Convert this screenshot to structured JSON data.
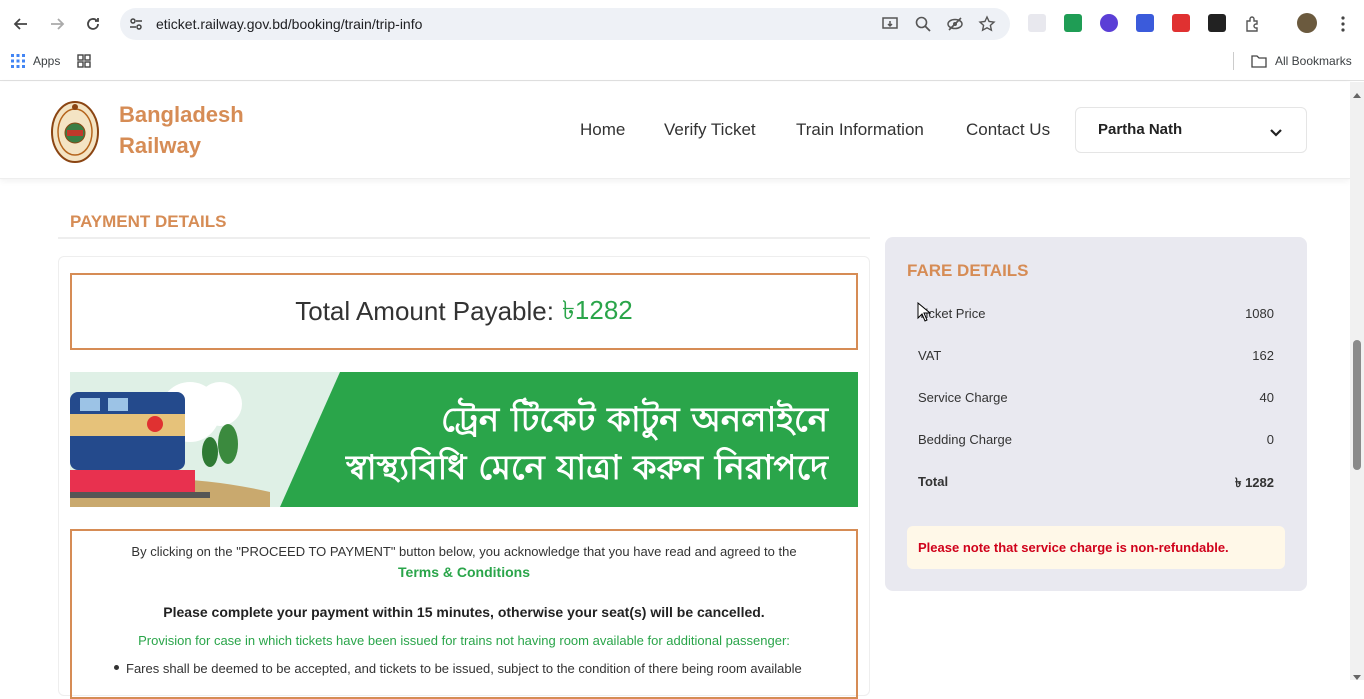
{
  "browser": {
    "url": "eticket.railway.gov.bd/booking/train/trip-info",
    "bookmarks": {
      "apps_label": "Apps",
      "all_bookmarks_label": "All Bookmarks"
    }
  },
  "site": {
    "brand_line1": "Bangladesh",
    "brand_line2": "Railway",
    "nav": [
      "Home",
      "Verify Ticket",
      "Train Information",
      "Contact Us"
    ],
    "user_name": "Partha Nath"
  },
  "payment": {
    "section_title": "PAYMENT DETAILS",
    "total_label": "Total Amount Payable:",
    "total_value": "৳1282",
    "banner_line1": "ট্রেন টিকেট কাটুন অনলাইনে",
    "banner_line2": "স্বাস্থ্যবিধি মেনে যাত্রা করুন নিরাপদে",
    "acknowledge_text": "By clicking on the \"PROCEED TO PAYMENT\" button below, you acknowledge that you have read and agreed to the",
    "terms_link": "Terms & Conditions",
    "warning": "Please complete your payment within 15 minutes, otherwise your seat(s) will be cancelled.",
    "provision": "Provision for case in which tickets have been issued for trains not having room available for additional passenger:",
    "bullet_1": "Fares shall be deemed to be accepted, and tickets to be issued, subject to the condition of there being room available"
  },
  "fare": {
    "title": "FARE DETAILS",
    "rows": [
      {
        "label": "Ticket Price",
        "value": "1080"
      },
      {
        "label": "VAT",
        "value": "162"
      },
      {
        "label": "Service Charge",
        "value": "40"
      },
      {
        "label": "Bedding Charge",
        "value": "0"
      },
      {
        "label": "Total",
        "value": "৳ 1282"
      }
    ],
    "note": "Please note that service charge is non-refundable."
  },
  "colors": {
    "brand": "#d68c55",
    "green": "#2aa54a",
    "alert": "#d0021b"
  }
}
